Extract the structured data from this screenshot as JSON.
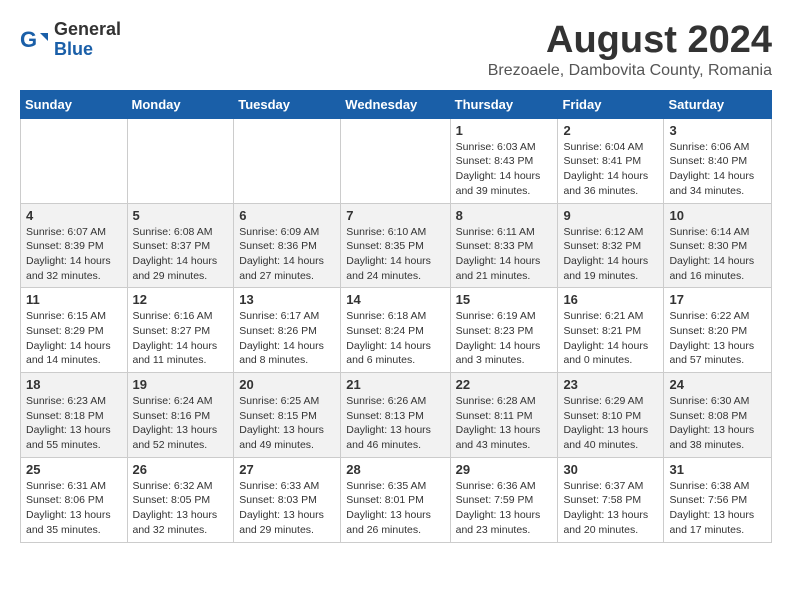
{
  "logo": {
    "general": "General",
    "blue": "Blue"
  },
  "title": {
    "month_year": "August 2024",
    "location": "Brezoaele, Dambovita County, Romania"
  },
  "days_of_week": [
    "Sunday",
    "Monday",
    "Tuesday",
    "Wednesday",
    "Thursday",
    "Friday",
    "Saturday"
  ],
  "weeks": [
    [
      {
        "day": "",
        "info": ""
      },
      {
        "day": "",
        "info": ""
      },
      {
        "day": "",
        "info": ""
      },
      {
        "day": "",
        "info": ""
      },
      {
        "day": "1",
        "info": "Sunrise: 6:03 AM\nSunset: 8:43 PM\nDaylight: 14 hours and 39 minutes."
      },
      {
        "day": "2",
        "info": "Sunrise: 6:04 AM\nSunset: 8:41 PM\nDaylight: 14 hours and 36 minutes."
      },
      {
        "day": "3",
        "info": "Sunrise: 6:06 AM\nSunset: 8:40 PM\nDaylight: 14 hours and 34 minutes."
      }
    ],
    [
      {
        "day": "4",
        "info": "Sunrise: 6:07 AM\nSunset: 8:39 PM\nDaylight: 14 hours and 32 minutes."
      },
      {
        "day": "5",
        "info": "Sunrise: 6:08 AM\nSunset: 8:37 PM\nDaylight: 14 hours and 29 minutes."
      },
      {
        "day": "6",
        "info": "Sunrise: 6:09 AM\nSunset: 8:36 PM\nDaylight: 14 hours and 27 minutes."
      },
      {
        "day": "7",
        "info": "Sunrise: 6:10 AM\nSunset: 8:35 PM\nDaylight: 14 hours and 24 minutes."
      },
      {
        "day": "8",
        "info": "Sunrise: 6:11 AM\nSunset: 8:33 PM\nDaylight: 14 hours and 21 minutes."
      },
      {
        "day": "9",
        "info": "Sunrise: 6:12 AM\nSunset: 8:32 PM\nDaylight: 14 hours and 19 minutes."
      },
      {
        "day": "10",
        "info": "Sunrise: 6:14 AM\nSunset: 8:30 PM\nDaylight: 14 hours and 16 minutes."
      }
    ],
    [
      {
        "day": "11",
        "info": "Sunrise: 6:15 AM\nSunset: 8:29 PM\nDaylight: 14 hours and 14 minutes."
      },
      {
        "day": "12",
        "info": "Sunrise: 6:16 AM\nSunset: 8:27 PM\nDaylight: 14 hours and 11 minutes."
      },
      {
        "day": "13",
        "info": "Sunrise: 6:17 AM\nSunset: 8:26 PM\nDaylight: 14 hours and 8 minutes."
      },
      {
        "day": "14",
        "info": "Sunrise: 6:18 AM\nSunset: 8:24 PM\nDaylight: 14 hours and 6 minutes."
      },
      {
        "day": "15",
        "info": "Sunrise: 6:19 AM\nSunset: 8:23 PM\nDaylight: 14 hours and 3 minutes."
      },
      {
        "day": "16",
        "info": "Sunrise: 6:21 AM\nSunset: 8:21 PM\nDaylight: 14 hours and 0 minutes."
      },
      {
        "day": "17",
        "info": "Sunrise: 6:22 AM\nSunset: 8:20 PM\nDaylight: 13 hours and 57 minutes."
      }
    ],
    [
      {
        "day": "18",
        "info": "Sunrise: 6:23 AM\nSunset: 8:18 PM\nDaylight: 13 hours and 55 minutes."
      },
      {
        "day": "19",
        "info": "Sunrise: 6:24 AM\nSunset: 8:16 PM\nDaylight: 13 hours and 52 minutes."
      },
      {
        "day": "20",
        "info": "Sunrise: 6:25 AM\nSunset: 8:15 PM\nDaylight: 13 hours and 49 minutes."
      },
      {
        "day": "21",
        "info": "Sunrise: 6:26 AM\nSunset: 8:13 PM\nDaylight: 13 hours and 46 minutes."
      },
      {
        "day": "22",
        "info": "Sunrise: 6:28 AM\nSunset: 8:11 PM\nDaylight: 13 hours and 43 minutes."
      },
      {
        "day": "23",
        "info": "Sunrise: 6:29 AM\nSunset: 8:10 PM\nDaylight: 13 hours and 40 minutes."
      },
      {
        "day": "24",
        "info": "Sunrise: 6:30 AM\nSunset: 8:08 PM\nDaylight: 13 hours and 38 minutes."
      }
    ],
    [
      {
        "day": "25",
        "info": "Sunrise: 6:31 AM\nSunset: 8:06 PM\nDaylight: 13 hours and 35 minutes."
      },
      {
        "day": "26",
        "info": "Sunrise: 6:32 AM\nSunset: 8:05 PM\nDaylight: 13 hours and 32 minutes."
      },
      {
        "day": "27",
        "info": "Sunrise: 6:33 AM\nSunset: 8:03 PM\nDaylight: 13 hours and 29 minutes."
      },
      {
        "day": "28",
        "info": "Sunrise: 6:35 AM\nSunset: 8:01 PM\nDaylight: 13 hours and 26 minutes."
      },
      {
        "day": "29",
        "info": "Sunrise: 6:36 AM\nSunset: 7:59 PM\nDaylight: 13 hours and 23 minutes."
      },
      {
        "day": "30",
        "info": "Sunrise: 6:37 AM\nSunset: 7:58 PM\nDaylight: 13 hours and 20 minutes."
      },
      {
        "day": "31",
        "info": "Sunrise: 6:38 AM\nSunset: 7:56 PM\nDaylight: 13 hours and 17 minutes."
      }
    ]
  ]
}
